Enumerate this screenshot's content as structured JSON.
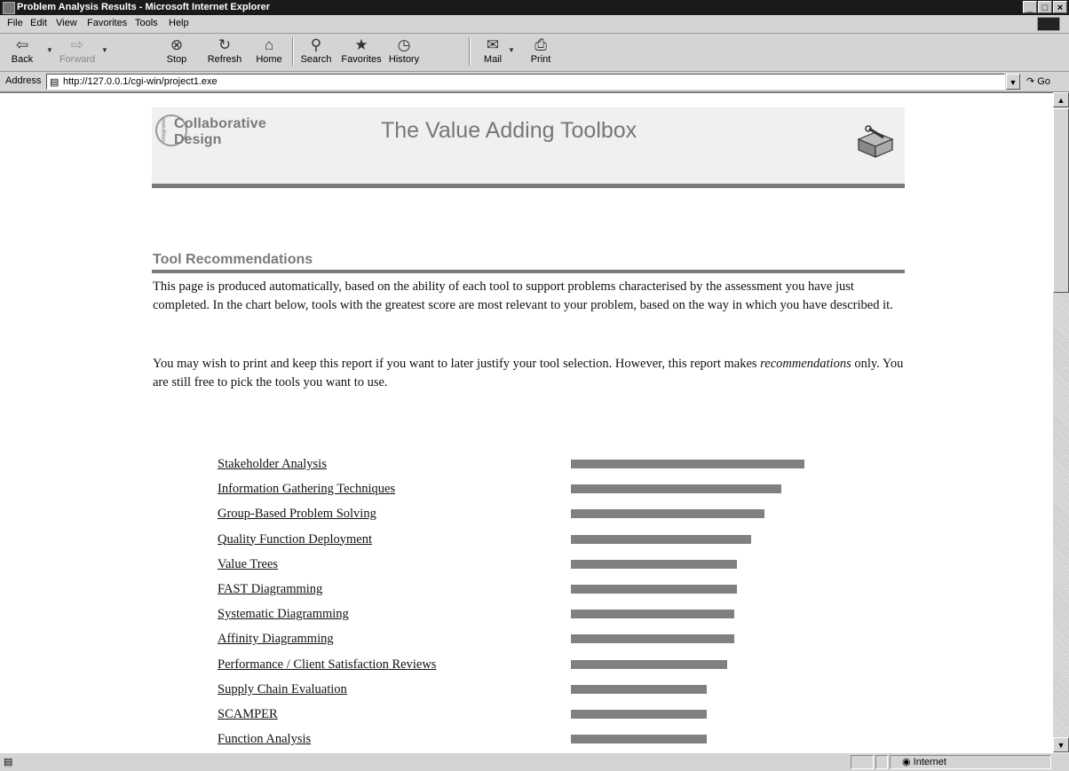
{
  "window": {
    "title": "Problem Analysis Results - Microsoft Internet Explorer",
    "controls": [
      "_",
      "□",
      "×"
    ]
  },
  "menu": [
    "File",
    "Edit",
    "View",
    "Favorites",
    "Tools",
    "Help"
  ],
  "toolbar": {
    "back": "Back",
    "forward": "Forward",
    "stop": "Stop",
    "refresh": "Refresh",
    "home": "Home",
    "search": "Search",
    "favorites": "Favorites",
    "history": "History",
    "mail": "Mail",
    "print": "Print"
  },
  "address": {
    "label": "Address",
    "url": "http://127.0.0.1/cgi-win/project1.exe",
    "go": "Go"
  },
  "status": {
    "zone": "Internet"
  },
  "page": {
    "logo_line1": "Collaborative",
    "logo_line2": "Design",
    "logo_side": "integrated",
    "banner_title": "The Value Adding Toolbox",
    "section_title": "Tool Recommendations",
    "para1": "This page is produced automatically, based on the ability of each tool to support problems characterised by the assessment you have just completed. In the chart below, tools with the greatest score are most relevant to your problem, based on the way in which you have described it.",
    "para2_before": "You may wish to print and keep this report if you want to later justify your tool selection. However, this report makes ",
    "para2_em": "recommendations",
    "para2_after": " only. You are still free to pick the tools you want to use."
  },
  "recommendations": [
    {
      "label": "Stakeholder Analysis",
      "score": 1.0
    },
    {
      "label": "Information Gathering Techniques",
      "score": 0.9
    },
    {
      "label": "Group-Based Problem Solving",
      "score": 0.83
    },
    {
      "label": "Quality Function Deployment",
      "score": 0.77
    },
    {
      "label": "Value Trees",
      "score": 0.71
    },
    {
      "label": "FAST Diagramming",
      "score": 0.71
    },
    {
      "label": "Systematic Diagramming",
      "score": 0.7
    },
    {
      "label": "Affinity Diagramming",
      "score": 0.7
    },
    {
      "label": "Performance / Client Satisfaction Reviews",
      "score": 0.67
    },
    {
      "label": "Supply Chain Evaluation",
      "score": 0.58
    },
    {
      "label": "SCAMPER",
      "score": 0.58
    },
    {
      "label": "Function Analysis",
      "score": 0.58
    }
  ]
}
